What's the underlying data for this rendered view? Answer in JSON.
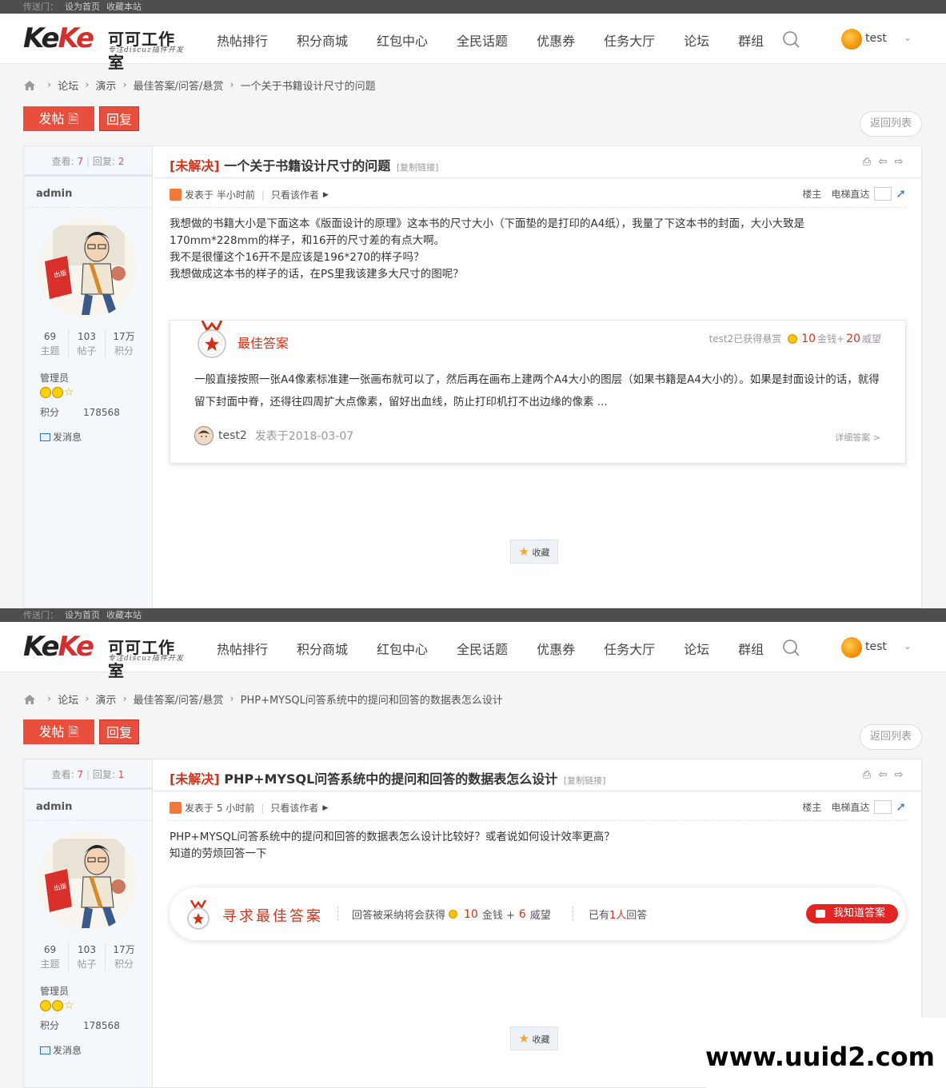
{
  "topbar": {
    "label": "传送门：",
    "set_home": "设为首页",
    "bookmark": "收藏本站"
  },
  "logo": {
    "en_part1": "Ke",
    "en_part2": "Ke",
    "cn": "可可工作室",
    "sub": "专注discuz插件开发"
  },
  "nav": [
    "热帖排行",
    "积分商城",
    "红包中心",
    "全民话题",
    "优惠券",
    "任务大厅",
    "论坛",
    "群组"
  ],
  "user": {
    "name": "test"
  },
  "buttons": {
    "post": "发帖",
    "reply": "回复",
    "back": "返回列表"
  },
  "posts": [
    {
      "breadcrumb": [
        "论坛",
        "演示",
        "最佳答案/问答/悬赏",
        "一个关于书籍设计尺寸的问题"
      ],
      "views_label": "查看:",
      "views": "7",
      "replies_label": "回复:",
      "replies": "2",
      "author": "admin",
      "stats": [
        {
          "num": "69",
          "label": "主题"
        },
        {
          "num": "103",
          "label": "帖子"
        },
        {
          "num": "17万",
          "label": "积分"
        }
      ],
      "role": "管理员",
      "credit_label": "积分",
      "credit_value": "178568",
      "send_msg": "发消息",
      "status": "[未解决]",
      "title": "一个关于书籍设计尺寸的问题",
      "copy_link": "[复制链接]",
      "posted": "发表于 半小时前",
      "only_author": "只看该作者",
      "floor": "楼主",
      "jump": "电梯直达",
      "content": [
        "我想做的书籍大小是下面这本《版面设计的原理》这本书的尺寸大小（下面垫的是打印的A4纸），我量了下这本书的封面，大小大致是170mm*228mm的样子，和16开的尺寸差的有点大啊。",
        "我不是很懂这个16开不是应该是196*270的样子吗？",
        "我想做成这本书的样子的话，在PS里我该建多大尺寸的图呢？"
      ],
      "best": {
        "title": "最佳答案",
        "reward_text": "test2已获得悬赏",
        "gold": "10",
        "gold_label": "金钱+",
        "prestige": "20",
        "prestige_label": "威望",
        "text": "一般直接按照一张A4像素标准建一张画布就可以了，然后再在画布上建两个A4大小的图层（如果书籍是A4大小的）。如果是封面设计的话，就得留下封面中脊，还得往四周扩大点像素，留好出血线，防止打印机打不出边缘的像素 ...",
        "user": "test2",
        "when": "发表于2018-03-07",
        "more": "详细答案 >"
      },
      "favorite": "收藏"
    },
    {
      "breadcrumb": [
        "论坛",
        "演示",
        "最佳答案/问答/悬赏",
        "PHP+MYSQL问答系统中的提问和回答的数据表怎么设计"
      ],
      "views_label": "查看:",
      "views": "7",
      "replies_label": "回复:",
      "replies": "1",
      "author": "admin",
      "stats": [
        {
          "num": "69",
          "label": "主题"
        },
        {
          "num": "103",
          "label": "帖子"
        },
        {
          "num": "17万",
          "label": "积分"
        }
      ],
      "role": "管理员",
      "credit_label": "积分",
      "credit_value": "178568",
      "send_msg": "发消息",
      "status": "[未解决]",
      "title": "PHP+MYSQL问答系统中的提问和回答的数据表怎么设计",
      "copy_link": "[复制链接]",
      "posted": "发表于 5 小时前",
      "only_author": "只看该作者",
      "floor": "楼主",
      "jump": "电梯直达",
      "content": [
        "PHP+MYSQL问答系统中的提问和回答的数据表怎么设计比较好？或者说如何设计效率更高？",
        "知道的劳烦回答一下"
      ],
      "seek": {
        "title": "寻求最佳答案",
        "info_prefix": "回答被采纳将会获得",
        "gold": "10",
        "gold_label": "金钱 +",
        "prestige": "6",
        "prestige_label": "威望",
        "answers_prefix": "已有",
        "answers_count": "1人",
        "answers_suffix": "回答",
        "button": "我知道答案"
      },
      "favorite": "收藏"
    }
  ],
  "watermark": "www.uuid2.com",
  "colors": {
    "accent": "#e94e3d",
    "status": "#d0331a",
    "button_red": "#e42323"
  }
}
